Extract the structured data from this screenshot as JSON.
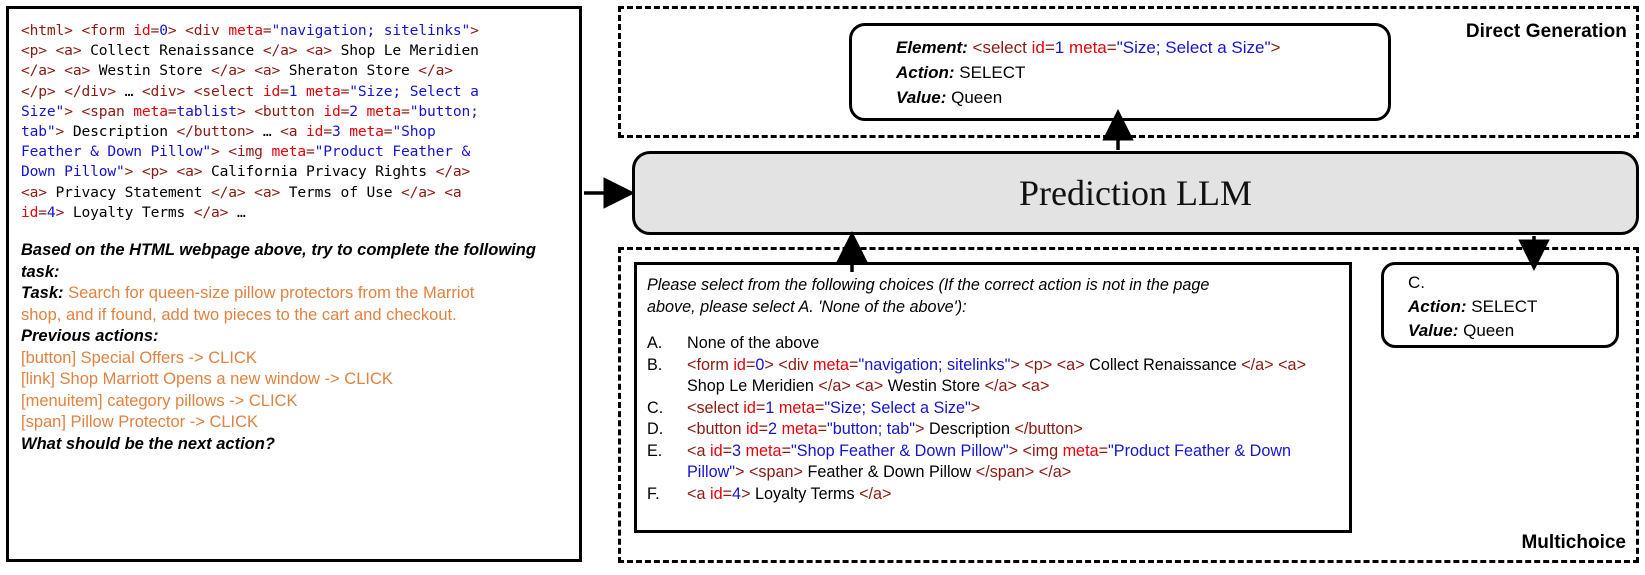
{
  "left_panel": {
    "html_code_tokens": [
      {
        "t": "<html> <form ",
        "c": "tag"
      },
      {
        "t": "id",
        "c": "attr"
      },
      {
        "t": "=",
        "c": "tag"
      },
      {
        "t": "0",
        "c": "val"
      },
      {
        "t": "> <div ",
        "c": "tag"
      },
      {
        "t": "meta",
        "c": "attr"
      },
      {
        "t": "=",
        "c": "tag"
      },
      {
        "t": "\"navigation; sitelinks\"",
        "c": "val"
      },
      {
        "t": ">",
        "c": "tag"
      },
      {
        "t": "\n",
        "c": "br"
      },
      {
        "t": "<p> <a> ",
        "c": "tag"
      },
      {
        "t": "Collect Renaissance ",
        "c": "txt"
      },
      {
        "t": "</a> <a> ",
        "c": "tag"
      },
      {
        "t": "Shop Le Meridien",
        "c": "txt"
      },
      {
        "t": "\n",
        "c": "br"
      },
      {
        "t": "</a> <a> ",
        "c": "tag"
      },
      {
        "t": "Westin Store ",
        "c": "txt"
      },
      {
        "t": "</a> <a> ",
        "c": "tag"
      },
      {
        "t": "Sheraton Store ",
        "c": "txt"
      },
      {
        "t": "</a>",
        "c": "tag"
      },
      {
        "t": "\n",
        "c": "br"
      },
      {
        "t": "</p> </div> ",
        "c": "tag"
      },
      {
        "t": "… ",
        "c": "txt"
      },
      {
        "t": "<div> <select ",
        "c": "tag"
      },
      {
        "t": "id",
        "c": "attr"
      },
      {
        "t": "=",
        "c": "tag"
      },
      {
        "t": "1",
        "c": "val"
      },
      {
        "t": " ",
        "c": "txt"
      },
      {
        "t": "meta",
        "c": "attr"
      },
      {
        "t": "=",
        "c": "tag"
      },
      {
        "t": "\"Size; Select a",
        "c": "val"
      },
      {
        "t": "\n",
        "c": "br"
      },
      {
        "t": "Size\"",
        "c": "val"
      },
      {
        "t": "> <span ",
        "c": "tag"
      },
      {
        "t": "meta",
        "c": "attr"
      },
      {
        "t": "=",
        "c": "tag"
      },
      {
        "t": "tablist",
        "c": "val"
      },
      {
        "t": "> <button ",
        "c": "tag"
      },
      {
        "t": "id",
        "c": "attr"
      },
      {
        "t": "=",
        "c": "tag"
      },
      {
        "t": "2",
        "c": "val"
      },
      {
        "t": " ",
        "c": "txt"
      },
      {
        "t": "meta",
        "c": "attr"
      },
      {
        "t": "=",
        "c": "tag"
      },
      {
        "t": "\"button;",
        "c": "val"
      },
      {
        "t": "\n",
        "c": "br"
      },
      {
        "t": "tab\"",
        "c": "val"
      },
      {
        "t": "> ",
        "c": "tag"
      },
      {
        "t": "Description ",
        "c": "txt"
      },
      {
        "t": "</button> ",
        "c": "tag"
      },
      {
        "t": "… ",
        "c": "txt"
      },
      {
        "t": "<a ",
        "c": "tag"
      },
      {
        "t": "id",
        "c": "attr"
      },
      {
        "t": "=",
        "c": "tag"
      },
      {
        "t": "3",
        "c": "val"
      },
      {
        "t": " ",
        "c": "txt"
      },
      {
        "t": "meta",
        "c": "attr"
      },
      {
        "t": "=",
        "c": "tag"
      },
      {
        "t": "\"Shop",
        "c": "val"
      },
      {
        "t": "\n",
        "c": "br"
      },
      {
        "t": "Feather & Down Pillow\"",
        "c": "val"
      },
      {
        "t": "> <img ",
        "c": "tag"
      },
      {
        "t": "meta",
        "c": "attr"
      },
      {
        "t": "=",
        "c": "tag"
      },
      {
        "t": "\"Product Feather &",
        "c": "val"
      },
      {
        "t": "\n",
        "c": "br"
      },
      {
        "t": "Down Pillow\"",
        "c": "val"
      },
      {
        "t": "> <p> <a> ",
        "c": "tag"
      },
      {
        "t": "California Privacy Rights ",
        "c": "txt"
      },
      {
        "t": "</a>",
        "c": "tag"
      },
      {
        "t": "\n",
        "c": "br"
      },
      {
        "t": "<a> ",
        "c": "tag"
      },
      {
        "t": "Privacy Statement ",
        "c": "txt"
      },
      {
        "t": "</a> <a> ",
        "c": "tag"
      },
      {
        "t": "Terms of Use ",
        "c": "txt"
      },
      {
        "t": "</a> <a",
        "c": "tag"
      },
      {
        "t": "\n",
        "c": "br"
      },
      {
        "t": " ",
        "c": "txt"
      },
      {
        "t": "id",
        "c": "attr"
      },
      {
        "t": "=",
        "c": "tag"
      },
      {
        "t": "4",
        "c": "val"
      },
      {
        "t": "> ",
        "c": "tag"
      },
      {
        "t": "Loyalty Terms ",
        "c": "txt"
      },
      {
        "t": "</a> ",
        "c": "tag"
      },
      {
        "t": "…",
        "c": "txt"
      }
    ],
    "intro_line_1": "Based on the HTML webpage above, try to complete the following",
    "intro_line_2": "task:",
    "task_label": "Task:",
    "task_text_line_1": " Search for queen-size pillow protectors from the Marriot",
    "task_text_line_2": "shop, and if found, add two pieces to the cart and checkout.",
    "previous_actions_label": "Previous actions:",
    "previous_actions": [
      "[button] Special Offers -> CLICK",
      "[link] Shop Marriott Opens a new window -> CLICK",
      "[menuitem] category pillows -> CLICK",
      "[span] Pillow Protector -> CLICK"
    ],
    "question": "What should be the next action?"
  },
  "direct_generation": {
    "region_label": "Direct Generation",
    "element_label": "Element:",
    "element_tokens": [
      {
        "t": " <select ",
        "c": "tag"
      },
      {
        "t": "id",
        "c": "attr"
      },
      {
        "t": "=",
        "c": "tag"
      },
      {
        "t": "1",
        "c": "val"
      },
      {
        "t": "  ",
        "c": "txt"
      },
      {
        "t": "meta",
        "c": "attr"
      },
      {
        "t": "=",
        "c": "tag"
      },
      {
        "t": "\"Size; Select a Size\"",
        "c": "val"
      },
      {
        "t": ">",
        "c": "tag"
      }
    ],
    "action_label": "Action:",
    "action_value": " SELECT",
    "value_label": "Value:",
    "value_value": " Queen"
  },
  "llm": {
    "title": "Prediction LLM"
  },
  "multichoice": {
    "region_label": "Multichoice",
    "instruction_line_1": "Please select from the following choices (If the correct action is not in the page",
    "instruction_line_2": "above, please select A. 'None of the above'):",
    "options": [
      {
        "letter": "A.",
        "tokens": [
          {
            "t": "None of the above",
            "c": "txt"
          }
        ]
      },
      {
        "letter": "B.",
        "tokens": [
          {
            "t": "<form ",
            "c": "tag"
          },
          {
            "t": "id",
            "c": "attr"
          },
          {
            "t": "=",
            "c": "tag"
          },
          {
            "t": "0",
            "c": "val"
          },
          {
            "t": "> <div ",
            "c": "tag"
          },
          {
            "t": "meta",
            "c": "attr"
          },
          {
            "t": "=",
            "c": "tag"
          },
          {
            "t": "\"navigation; sitelinks\"",
            "c": "val"
          },
          {
            "t": "> <p> <a> ",
            "c": "tag"
          },
          {
            "t": "Collect Renaissance ",
            "c": "txt"
          },
          {
            "t": "</a> <a> ",
            "c": "tag"
          },
          {
            "t": "Shop Le Meridien ",
            "c": "txt"
          },
          {
            "t": "</a> <a> ",
            "c": "tag"
          },
          {
            "t": "Westin Store ",
            "c": "txt"
          },
          {
            "t": "</a> <a>",
            "c": "tag"
          }
        ]
      },
      {
        "letter": "C.",
        "tokens": [
          {
            "t": "<select ",
            "c": "tag"
          },
          {
            "t": "id",
            "c": "attr"
          },
          {
            "t": "=",
            "c": "tag"
          },
          {
            "t": "1",
            "c": "val"
          },
          {
            "t": "  ",
            "c": "txt"
          },
          {
            "t": "meta",
            "c": "attr"
          },
          {
            "t": "=",
            "c": "tag"
          },
          {
            "t": "\"Size; Select a Size\"",
            "c": "val"
          },
          {
            "t": ">",
            "c": "tag"
          }
        ]
      },
      {
        "letter": "D.",
        "tokens": [
          {
            "t": "<button ",
            "c": "tag"
          },
          {
            "t": "id",
            "c": "attr"
          },
          {
            "t": "=",
            "c": "tag"
          },
          {
            "t": "2",
            "c": "val"
          },
          {
            "t": "  ",
            "c": "txt"
          },
          {
            "t": "meta",
            "c": "attr"
          },
          {
            "t": "=",
            "c": "tag"
          },
          {
            "t": "\"button; tab\"",
            "c": "val"
          },
          {
            "t": "> ",
            "c": "tag"
          },
          {
            "t": "Description ",
            "c": "txt"
          },
          {
            "t": "</button>",
            "c": "tag"
          }
        ]
      },
      {
        "letter": "E.",
        "tokens": [
          {
            "t": "<a ",
            "c": "tag"
          },
          {
            "t": "id",
            "c": "attr"
          },
          {
            "t": "=",
            "c": "tag"
          },
          {
            "t": "3",
            "c": "val"
          },
          {
            "t": " ",
            "c": "txt"
          },
          {
            "t": "meta",
            "c": "attr"
          },
          {
            "t": "=",
            "c": "tag"
          },
          {
            "t": "\"Shop Feather & Down Pillow\"",
            "c": "val"
          },
          {
            "t": "> <img ",
            "c": "tag"
          },
          {
            "t": "meta",
            "c": "attr"
          },
          {
            "t": "=",
            "c": "tag"
          },
          {
            "t": "\"Product Feather & Down Pillow\"",
            "c": "val"
          },
          {
            "t": "> <span> ",
            "c": "tag"
          },
          {
            "t": "Feather & Down Pillow ",
            "c": "txt"
          },
          {
            "t": "</span> </a>",
            "c": "tag"
          }
        ]
      },
      {
        "letter": "F.",
        "tokens": [
          {
            "t": "<a ",
            "c": "tag"
          },
          {
            "t": "id",
            "c": "attr"
          },
          {
            "t": "=",
            "c": "tag"
          },
          {
            "t": "4",
            "c": "val"
          },
          {
            "t": "> ",
            "c": "tag"
          },
          {
            "t": "Loyalty Terms ",
            "c": "txt"
          },
          {
            "t": "</a>",
            "c": "tag"
          }
        ]
      }
    ]
  },
  "answer": {
    "choice_letter": "C.",
    "action_label": "Action:",
    "action_value": " SELECT",
    "value_label": "Value:",
    "value_value": " Queen"
  },
  "colors": {
    "tag": "#8B1A10",
    "attribute": "#E8000B",
    "value": "#1414D2",
    "text": "#000000",
    "task_orange": "#E08240",
    "llm_fill": "#E3E3E3"
  }
}
